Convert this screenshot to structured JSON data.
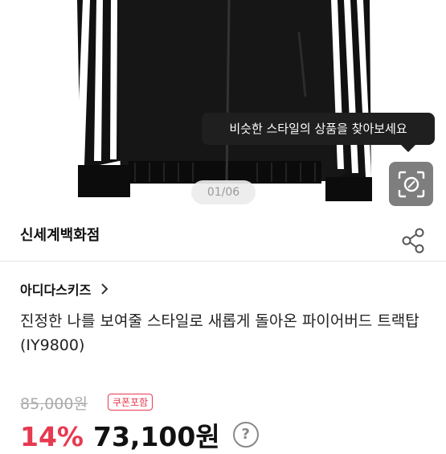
{
  "tooltip": {
    "text": "비슷한 스타일의 상품을 찾아보세요"
  },
  "gallery": {
    "page_indicator": "01/06"
  },
  "store": {
    "name": "신세계백화점"
  },
  "product": {
    "brand": "아디다스키즈",
    "title": "진정한 나를 보여줄 스타일로 새롭게 돌아온 파이어버드 트랙탑(IY9800)",
    "original_price": "85,000원",
    "coupon_badge": "쿠폰포함",
    "discount": "14%",
    "price": "73,100원",
    "help_icon": "?"
  },
  "colors": {
    "accent": "#e73950",
    "jacket": "#111111",
    "stripe": "#ffffff"
  },
  "icons": [
    "camera-lens-icon",
    "share-icon",
    "chevron-right-icon",
    "question-icon"
  ]
}
